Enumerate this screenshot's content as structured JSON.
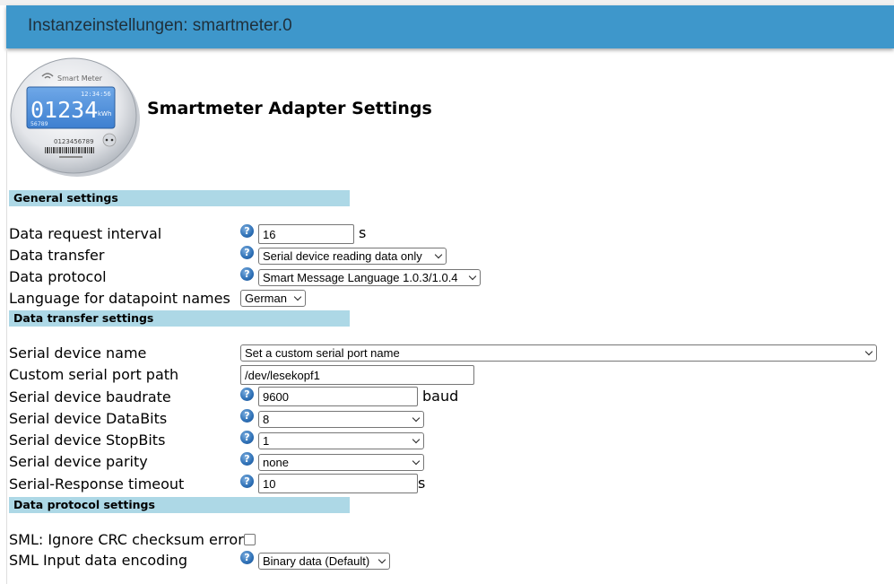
{
  "header": {
    "title": "Instanzeinstellungen: smartmeter.0"
  },
  "app": {
    "title": "Smartmeter Adapter Settings",
    "logo": {
      "brand": "Smart Meter",
      "time": "12:34:56",
      "reading": "01234",
      "unit": "kWh",
      "sub": "56789",
      "serial": "0123456789"
    }
  },
  "sections": {
    "general": "General settings",
    "transfer": "Data transfer settings",
    "protocol": "Data protocol settings"
  },
  "general": {
    "interval_label": "Data request interval",
    "interval_value": "16",
    "interval_unit": "s",
    "transfer_label": "Data transfer",
    "transfer_value": "Serial device reading data only",
    "protocol_label": "Data protocol",
    "protocol_value": "Smart Message Language 1.0.3/1.0.4",
    "language_label": "Language for datapoint names",
    "language_value": "German"
  },
  "transfer": {
    "device_name_label": "Serial device name",
    "device_name_value": "Set a custom serial port name",
    "custom_path_label": "Custom serial port path",
    "custom_path_value": "/dev/lesekopf1",
    "baud_label": "Serial device baudrate",
    "baud_value": "9600",
    "baud_unit": "baud",
    "databits_label": "Serial device DataBits",
    "databits_value": "8",
    "stopbits_label": "Serial device StopBits",
    "stopbits_value": "1",
    "parity_label": "Serial device parity",
    "parity_value": "none",
    "timeout_label": "Serial-Response timeout",
    "timeout_value": "10",
    "timeout_unit": "s"
  },
  "protocol": {
    "crc_label": "SML: Ignore CRC checksum error",
    "crc_checked": false,
    "encoding_label": "SML Input data encoding",
    "encoding_value": "Binary data (Default)"
  },
  "icons": {
    "help": "help-icon",
    "dropdown": "chevron-down-icon"
  },
  "colors": {
    "header": "#3e97cb",
    "section": "#add8e6",
    "help": "#2d6fb5"
  }
}
